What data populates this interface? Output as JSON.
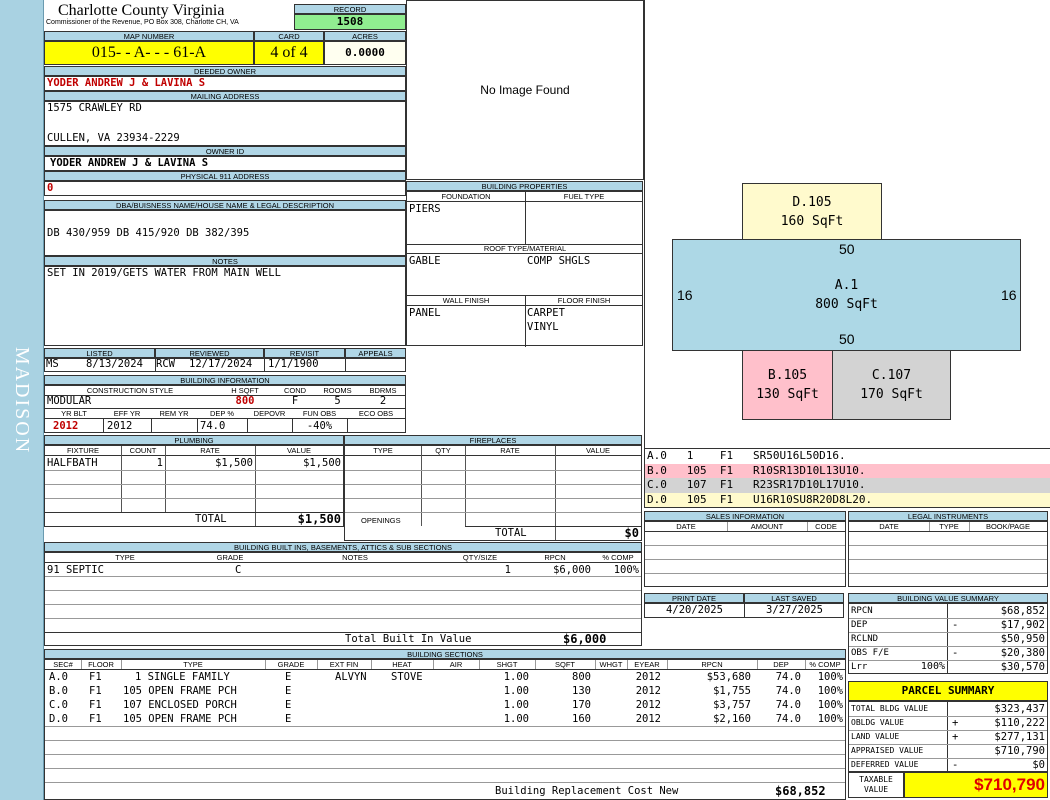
{
  "county": "Charlotte County Virginia",
  "commissioner": "Commissioner of the Revenue, PO Box 308, Charlotte CH, VA",
  "record": {
    "label": "RECORD",
    "value": "1508"
  },
  "map_number": {
    "label": "MAP NUMBER",
    "value": "015- - A- - - 61-A"
  },
  "card": {
    "label": "CARD",
    "value": "4 of 4"
  },
  "acres": {
    "label": "ACRES",
    "value": "0.0000"
  },
  "deeded_owner": {
    "label": "DEEDED OWNER",
    "value": "YODER ANDREW J & LAVINA S"
  },
  "mailing_address": {
    "label": "MAILING ADDRESS",
    "line1": "1575 CRAWLEY RD",
    "line2": "CULLEN, VA 23934-2229"
  },
  "owner_id": {
    "label": "OWNER ID",
    "value": "YODER ANDREW J & LAVINA S"
  },
  "physical_address": {
    "label": "PHYSICAL 911 ADDRESS",
    "value": "0"
  },
  "dba": {
    "label": "DBA/BUISNESS NAME/HOUSE NAME & LEGAL DESCRIPTION",
    "value": "DB 430/959 DB 415/920 DB 382/395"
  },
  "notes": {
    "label": "NOTES",
    "value": "SET IN 2019/GETS WATER FROM MAIN WELL"
  },
  "photo": {
    "text": "No Image Found"
  },
  "building_props": {
    "label": "BUILDING PROPERTIES",
    "foundation_label": "FOUNDATION",
    "foundation": "PIERS",
    "fuel_label": "FUEL TYPE",
    "fuel": "",
    "roof_label": "ROOF TYPE/MATERIAL",
    "roof_type": "GABLE",
    "roof_material": "COMP SHGLS",
    "wall_label": "WALL FINISH",
    "wall": "PANEL",
    "floor_label": "FLOOR FINISH",
    "floor1": "CARPET",
    "floor2": "VINYL"
  },
  "review": {
    "listed_label": "LISTED",
    "listed_by": "MS",
    "listed_date": "8/13/2024",
    "reviewed_label": "REVIEWED",
    "reviewed_by": "RCW",
    "reviewed_date": "12/17/2024",
    "revisit_label": "REVISIT",
    "revisit": "1/1/1900",
    "appeals_label": "APPEALS",
    "appeals": ""
  },
  "building_info": {
    "label": "BUILDING INFORMATION",
    "style_label": "CONSTRUCTION STYLE",
    "style": "MODULAR",
    "hsqft_label": "H SQFT",
    "hsqft": "800",
    "cond_label": "COND",
    "cond": "F",
    "rooms_label": "ROOMS",
    "rooms": "5",
    "bdrms_label": "BDRMS",
    "bdrms": "2",
    "yrblt_label": "YR BLT",
    "yrblt": "2012",
    "effyr_label": "EFF YR",
    "effyr": "2012",
    "remyr_label": "REM YR",
    "remyr": "",
    "dep_label": "DEP %",
    "dep": "74.0",
    "depovr_label": "DEPOVR",
    "depovr": "",
    "funobs_label": "FUN OBS",
    "funobs": "-40%",
    "ecoobs_label": "ECO OBS",
    "ecoobs": ""
  },
  "plumbing": {
    "label": "PLUMBING",
    "headers": [
      "FIXTURE",
      "COUNT",
      "RATE",
      "VALUE"
    ],
    "rows": [
      {
        "fixture": "HALFBATH",
        "count": "1",
        "rate": "$1,500",
        "value": "$1,500"
      }
    ],
    "total_label": "TOTAL",
    "total": "$1,500"
  },
  "fireplaces": {
    "label": "FIREPLACES",
    "headers": [
      "TYPE",
      "QTY",
      "RATE",
      "VALUE"
    ],
    "openings_label": "OPENINGS",
    "total_label": "TOTAL",
    "total": "$0"
  },
  "builtins": {
    "label": "BUILDING BUILT INS, BASEMENTS, ATTICS & SUB SECTIONS",
    "headers": [
      "TYPE",
      "GRADE",
      "NOTES",
      "QTY/SIZE",
      "RPCN",
      "% COMP"
    ],
    "rows": [
      {
        "type": "91 SEPTIC",
        "grade": "C",
        "notes": "",
        "qty": "1",
        "rpcn": "$6,000",
        "comp": "100%"
      }
    ],
    "total_label": "Total Built In Value",
    "total": "$6,000"
  },
  "sketch": {
    "sections": [
      {
        "id": "D.105",
        "area": "160 SqFt"
      },
      {
        "id": "A.1",
        "area": "800 SqFt"
      },
      {
        "id": "B.105",
        "area": "130 SqFt"
      },
      {
        "id": "C.107",
        "area": "170 SqFt"
      }
    ],
    "dims": {
      "top": "50",
      "bottom": "50",
      "left": "16",
      "right": "16"
    }
  },
  "vectors": [
    {
      "text": "A.0   1    F1   SR50U16L50D16.",
      "color": "#ffffff"
    },
    {
      "text": "B.0   105  F1   R10SR13D10L13U10.",
      "color": "#ffc0cb"
    },
    {
      "text": "C.0   107  F1   R23SR17D10L17U10.",
      "color": "#d3d3d3"
    },
    {
      "text": "D.0   105  F1   U16R10SU8R20D8L20.",
      "color": "#fffacd"
    }
  ],
  "sales": {
    "label": "SALES INFORMATION",
    "headers": [
      "DATE",
      "AMOUNT",
      "CODE"
    ]
  },
  "legal": {
    "label": "LEGAL INSTRUMENTS",
    "headers": [
      "DATE",
      "TYPE",
      "BOOK/PAGE"
    ]
  },
  "print": {
    "print_label": "PRINT DATE",
    "print_date": "4/20/2025",
    "saved_label": "LAST SAVED",
    "saved_date": "3/27/2025"
  },
  "value_summary": {
    "label": "BUILDING VALUE SUMMARY",
    "rows": [
      {
        "label": "RPCN",
        "sign": "",
        "value": "$68,852"
      },
      {
        "label": "DEP",
        "sign": "-",
        "value": "$17,902"
      },
      {
        "label": "RCLND",
        "sign": "",
        "value": "$50,950"
      },
      {
        "label": "OBS F/E",
        "sign": "-",
        "value": "$20,380"
      },
      {
        "label": "Lrr",
        "pct": "100%",
        "sign": "",
        "value": "$30,570"
      }
    ]
  },
  "parcel_summary": {
    "label": "PARCEL SUMMARY",
    "rows": [
      {
        "label": "TOTAL BLDG VALUE",
        "sign": "",
        "value": "$323,437"
      },
      {
        "label": "OBLDG VALUE",
        "sign": "+",
        "value": "$110,222"
      },
      {
        "label": "LAND VALUE",
        "sign": "+",
        "value": "$277,131"
      },
      {
        "label": "APPRAISED VALUE",
        "sign": "",
        "value": "$710,790"
      },
      {
        "label": "DEFERRED VALUE",
        "sign": "-",
        "value": "$0"
      }
    ],
    "taxable_label": "TAXABLE VALUE",
    "taxable": "$710,790"
  },
  "sections": {
    "label": "BUILDING SECTIONS",
    "headers": [
      "SEC#",
      "FLOOR",
      "TYPE",
      "GRADE",
      "EXT FIN",
      "HEAT",
      "AIR",
      "SHGT",
      "SQFT",
      "WHGT",
      "EYEAR",
      "RPCN",
      "DEP",
      "% COMP"
    ],
    "rows": [
      {
        "sec": "A.0",
        "floor": "F1",
        "type": "1 SINGLE FAMILY",
        "grade": "E",
        "ext": "ALVYN",
        "heat": "STOVE",
        "air": "",
        "shgt": "1.00",
        "sqft": "800",
        "whgt": "",
        "eyear": "2012",
        "rpcn": "$53,680",
        "dep": "74.0",
        "comp": "100%"
      },
      {
        "sec": "B.0",
        "floor": "F1",
        "type": "105 OPEN FRAME PCH",
        "grade": "E",
        "ext": "",
        "heat": "",
        "air": "",
        "shgt": "1.00",
        "sqft": "130",
        "whgt": "",
        "eyear": "2012",
        "rpcn": "$1,755",
        "dep": "74.0",
        "comp": "100%"
      },
      {
        "sec": "C.0",
        "floor": "F1",
        "type": "107 ENCLOSED PORCH",
        "grade": "E",
        "ext": "",
        "heat": "",
        "air": "",
        "shgt": "1.00",
        "sqft": "170",
        "whgt": "",
        "eyear": "2012",
        "rpcn": "$3,757",
        "dep": "74.0",
        "comp": "100%"
      },
      {
        "sec": "D.0",
        "floor": "F1",
        "type": "105 OPEN FRAME PCH",
        "grade": "E",
        "ext": "",
        "heat": "",
        "air": "",
        "shgt": "1.00",
        "sqft": "160",
        "whgt": "",
        "eyear": "2012",
        "rpcn": "$2,160",
        "dep": "74.0",
        "comp": "100%"
      }
    ],
    "total_label": "Building Replacement Cost New",
    "total": "$68,852"
  },
  "sidebar_text": "MADISON"
}
